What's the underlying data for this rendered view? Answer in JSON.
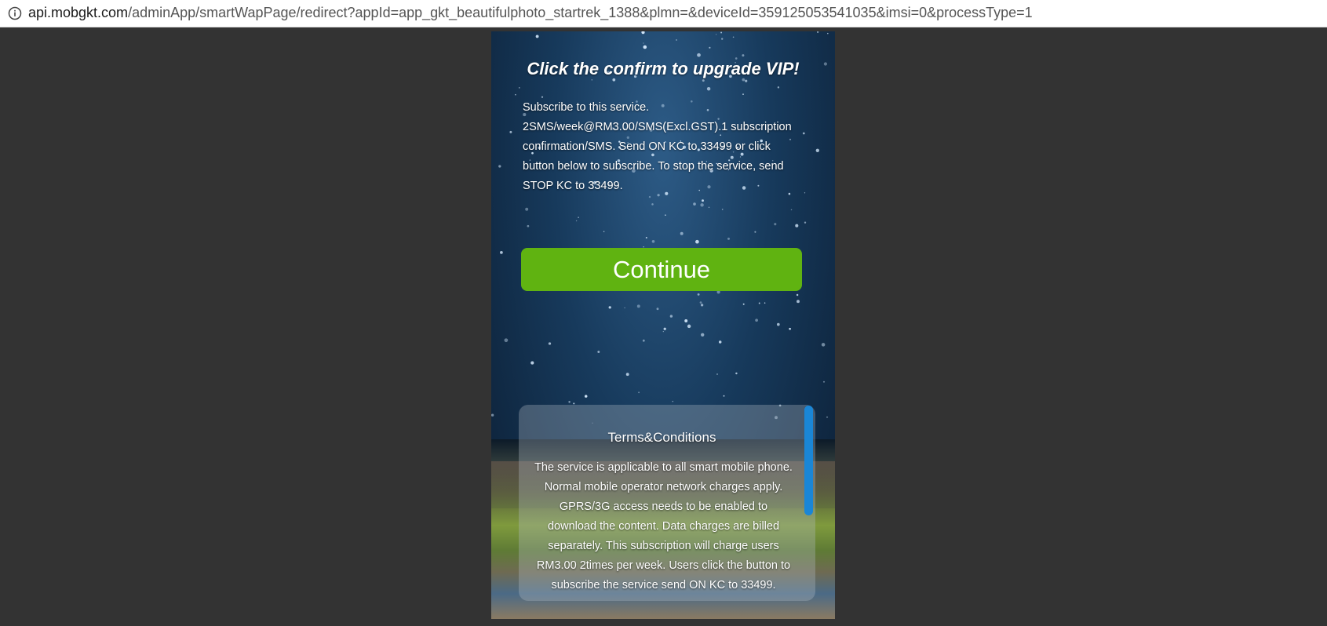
{
  "browser": {
    "url_host": "api.mobgkt.com",
    "url_path": "/adminApp/smartWapPage/redirect?appId=app_gkt_beautifulphoto_startrek_1388&plmn=&deviceId=359125053541035&imsi=0&processType=1",
    "info_icon": "info-icon"
  },
  "page": {
    "headline": "Click the confirm to upgrade VIP!",
    "description_lines": [
      "Subscribe to this service.",
      "2SMS/week@RM3.00/SMS(Excl.GST).1 subscription",
      "confirmation/SMS. Send ON KC to 33499 or click",
      "button below to subscribe. To stop the service, send",
      "STOP KC to 33499."
    ],
    "continue_label": "Continue",
    "button_color": "#60b311",
    "terms": {
      "title": "Terms&Conditions",
      "body_lines": [
        "The service is applicable to all smart mobile phone.",
        "Normal mobile operator network charges apply.",
        "GPRS/3G access needs to be enabled to",
        "download the content. Data charges are billed",
        "separately. This subscription will charge users",
        "RM3.00 2times per week. Users click the button to",
        "subscribe the service send ON KC to 33499."
      ]
    }
  }
}
